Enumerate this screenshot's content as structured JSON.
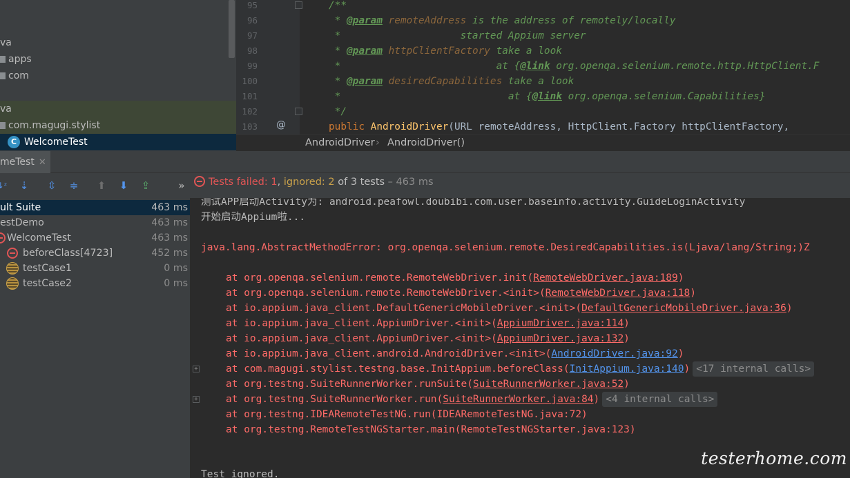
{
  "project_tree": {
    "rows": [
      {
        "label": "va"
      },
      {
        "label": "apps"
      },
      {
        "label": "com"
      },
      {
        "label": "va"
      },
      {
        "label": "com.magugi.stylist"
      },
      {
        "label": "WelcomeTest"
      }
    ]
  },
  "editor": {
    "lines": [
      {
        "n": "95"
      },
      {
        "n": "96"
      },
      {
        "n": "97"
      },
      {
        "n": "98"
      },
      {
        "n": "99"
      },
      {
        "n": "100"
      },
      {
        "n": "101"
      },
      {
        "n": "102"
      },
      {
        "n": "103"
      }
    ],
    "code": {
      "l95": "/**",
      "l96_star": " * ",
      "l96_tag": "@param",
      "l96_param": " remoteAddress",
      "l96_rest": " is the address of remotely/locally",
      "l97": " *                    started Appium server",
      "l98_star": " * ",
      "l98_tag": "@param",
      "l98_param": " httpClientFactory",
      "l98_rest": " take a look",
      "l99_star": " *                          at {",
      "l99_tag": "@link",
      "l99_rest": " org.openqa.selenium.remote.http.HttpClient.F",
      "l100_star": " * ",
      "l100_tag": "@param",
      "l100_param": " desiredCapabilities",
      "l100_rest": " take a look",
      "l101_star": " *                            at {",
      "l101_tag": "@link",
      "l101_rest": " org.openqa.selenium.Capabilities}",
      "l102": " */",
      "l103_kw": "public ",
      "l103_fn": "AndroidDriver",
      "l103_rest": "(URL remoteAddress, HttpClient.Factory httpClientFactory,"
    },
    "at_mark": "@",
    "breadcrumb": {
      "first": "AndroidDriver",
      "sep": "›",
      "second": "AndroidDriver()"
    }
  },
  "run_panel": {
    "tab_label": "meTest",
    "close": "✕",
    "overflow": "»",
    "status": {
      "failed": "Tests failed: 1",
      "sep": ", ",
      "ignored": "ignored: 2",
      "rest": " of 3 tests",
      "time": " – 463 ms"
    }
  },
  "test_tree": {
    "rows": [
      {
        "name": "ult Suite",
        "time": "463 ms"
      },
      {
        "name": "estDemo",
        "time": "463 ms"
      },
      {
        "name": "WelcomeTest",
        "time": "463 ms"
      },
      {
        "name": "beforeClass[4723]",
        "time": "452 ms"
      },
      {
        "name": "testCase1",
        "time": "0 ms"
      },
      {
        "name": "testCase2",
        "time": "0 ms"
      }
    ]
  },
  "console": {
    "l1": "测试APP启动Activity为: android.peafowl.doubibi.com.user.baseinfo.activity.GuideLoginActivity",
    "l2": "开始启动Appium啦...",
    "l3": "java.lang.AbstractMethodError: org.openqa.selenium.remote.DesiredCapabilities.is(Ljava/lang/String;)Z",
    "stack": [
      {
        "pre": "at org.openqa.selenium.remote.RemoteWebDriver.init(",
        "link": "RemoteWebDriver.java:189",
        "post": ")"
      },
      {
        "pre": "at org.openqa.selenium.remote.RemoteWebDriver.<init>(",
        "link": "RemoteWebDriver.java:118",
        "post": ")"
      },
      {
        "pre": "at io.appium.java_client.DefaultGenericMobileDriver.<init>(",
        "link": "DefaultGenericMobileDriver.java:36",
        "post": ")"
      },
      {
        "pre": "at io.appium.java_client.AppiumDriver.<init>(",
        "link": "AppiumDriver.java:114",
        "post": ")"
      },
      {
        "pre": "at io.appium.java_client.AppiumDriver.<init>(",
        "link": "AppiumDriver.java:132",
        "post": ")"
      },
      {
        "pre": "at io.appium.java_client.android.AndroidDriver.<init>(",
        "link": "AndroidDriver.java:92",
        "post": ")"
      },
      {
        "pre": "at com.magugi.stylist.testng.base.InitAppium.beforeClass(",
        "link": "InitAppium.java:140",
        "post": ")",
        "internal": "<17 internal calls>"
      },
      {
        "pre": "at org.testng.SuiteRunnerWorker.runSuite(",
        "link": "SuiteRunnerWorker.java:52",
        "post": ")"
      },
      {
        "pre": "at org.testng.SuiteRunnerWorker.run(",
        "link": "SuiteRunnerWorker.java:84",
        "post": ")",
        "internal": "<4 internal calls>"
      },
      {
        "pre": "at org.testng.IDEARemoteTestNG.run(IDEARemoteTestNG.java:72)",
        "link": "",
        "post": ""
      },
      {
        "pre": "at org.testng.RemoteTestNGStarter.main(RemoteTestNGStarter.java:123)",
        "link": "",
        "post": ""
      }
    ],
    "last": "Test ignored."
  },
  "watermark": "testerhome.com",
  "colors": {
    "error": "#ff6b68",
    "link_blue": "#5394ec",
    "selection": "#0d293e",
    "panel": "#3c3f41",
    "editor_bg": "#2b2b2b"
  }
}
